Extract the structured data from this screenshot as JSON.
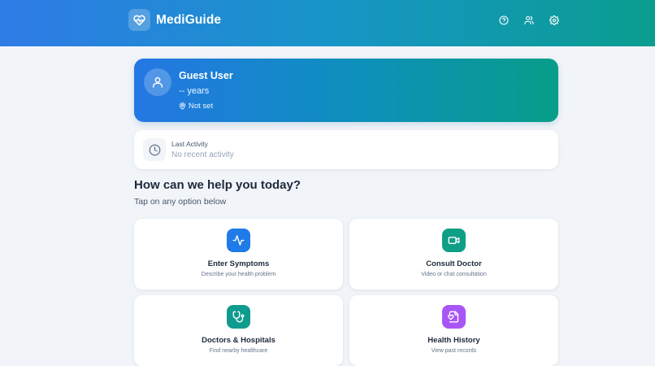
{
  "header": {
    "brand": "MediGuide",
    "icons": [
      "heart-pulse-icon",
      "help-circle-icon",
      "users-icon",
      "settings-icon"
    ]
  },
  "profile": {
    "name": "Guest User",
    "age": "-- years",
    "location": "Not set"
  },
  "activity": {
    "title": "Last Activity",
    "value": "No recent activity"
  },
  "help": {
    "title": "How can we help you today?",
    "subtitle": "Tap on any option below"
  },
  "cards": [
    {
      "title": "Enter Symptoms",
      "subtitle": "Describe your health problem",
      "icon": "activity-icon",
      "color": "#1f7be8"
    },
    {
      "title": "Consult Doctor",
      "subtitle": "Video or chat consultation",
      "icon": "video-icon",
      "color": "#0e9f86"
    },
    {
      "title": "Doctors & Hospitals",
      "subtitle": "Find nearby healthcare",
      "icon": "stethoscope-icon",
      "color": "#0f9b8e"
    },
    {
      "title": "Health History",
      "subtitle": "View past records",
      "icon": "file-heart-icon",
      "color": "#a855f7"
    }
  ],
  "colors": {
    "header_gradient_start": "#2f7be6",
    "header_gradient_end": "#0a9d8f",
    "background": "#f1f5f9"
  }
}
